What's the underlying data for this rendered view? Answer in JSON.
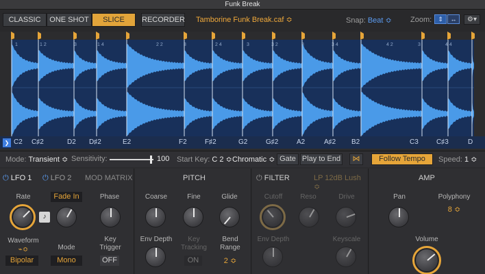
{
  "window": {
    "title": "Funk Break"
  },
  "toolbar": {
    "modes": [
      "CLASSIC",
      "ONE SHOT",
      "SLICE"
    ],
    "active_mode": "SLICE",
    "recorder": "RECORDER",
    "filename": "Tamborine Funk Break.caf ≎",
    "snap_label": "Snap:",
    "snap_value": "Beat ≎",
    "zoom_label": "Zoom:"
  },
  "ruler": {
    "beats": [
      "1",
      "1 2",
      "3",
      "1 4",
      "2 2",
      "3",
      "2 4",
      "3",
      "3 2",
      "3",
      "3 4",
      "4 2",
      "3",
      "4 4"
    ]
  },
  "slices": {
    "notes": [
      "C2",
      "C♯2",
      "D2",
      "D♯2",
      "E2",
      "F2",
      "F♯2",
      "G2",
      "G♯2",
      "A2",
      "A♯2",
      "B2",
      "C3",
      "C♯3",
      "D"
    ]
  },
  "controls": {
    "mode_label": "Mode:",
    "mode_value": "Transient ≎",
    "sensitivity_label": "Sensitivity:",
    "sensitivity_value": "100",
    "start_key_label": "Start Key:",
    "start_key_value": "C 2 ≎",
    "chromatic": "Chromatic ≎",
    "gate": "Gate",
    "play_to_end": "Play to End",
    "follow_tempo": "Follow Tempo",
    "speed_label": "Speed:",
    "speed_value": "1 ≎",
    "sensitivity_level": 0.95
  },
  "lfo": {
    "tabs": [
      "LFO 1",
      "LFO 2",
      "MOD MATRIX"
    ],
    "rate": "Rate",
    "fade_in": "Fade In",
    "phase": "Phase",
    "waveform": "Waveform",
    "waveform_value": "Bipolar",
    "mode": "Mode",
    "mode_value": "Mono",
    "key_trigger": "Key\nTrigger",
    "key_trigger_value": "OFF"
  },
  "pitch": {
    "title": "PITCH",
    "coarse": "Coarse",
    "fine": "Fine",
    "glide": "Glide",
    "env_depth": "Env Depth",
    "key_tracking": "Key\nTracking",
    "key_tracking_value": "ON",
    "bend_range": "Bend\nRange",
    "bend_value": "2 ≎"
  },
  "filter": {
    "title": "FILTER",
    "type": "LP 12dB Lush ≎",
    "cutoff": "Cutoff",
    "reso": "Reso",
    "drive": "Drive",
    "env_depth": "Env Depth",
    "keyscale": "Keyscale"
  },
  "amp": {
    "title": "AMP",
    "pan": "Pan",
    "polyphony": "Polyphony",
    "polyphony_value": "8 ≎",
    "volume": "Volume"
  },
  "colors": {
    "accent": "#e6a539",
    "wave": "#4a9ae8",
    "wave_bg": "#18305a",
    "blue": "#5b9bf0"
  }
}
